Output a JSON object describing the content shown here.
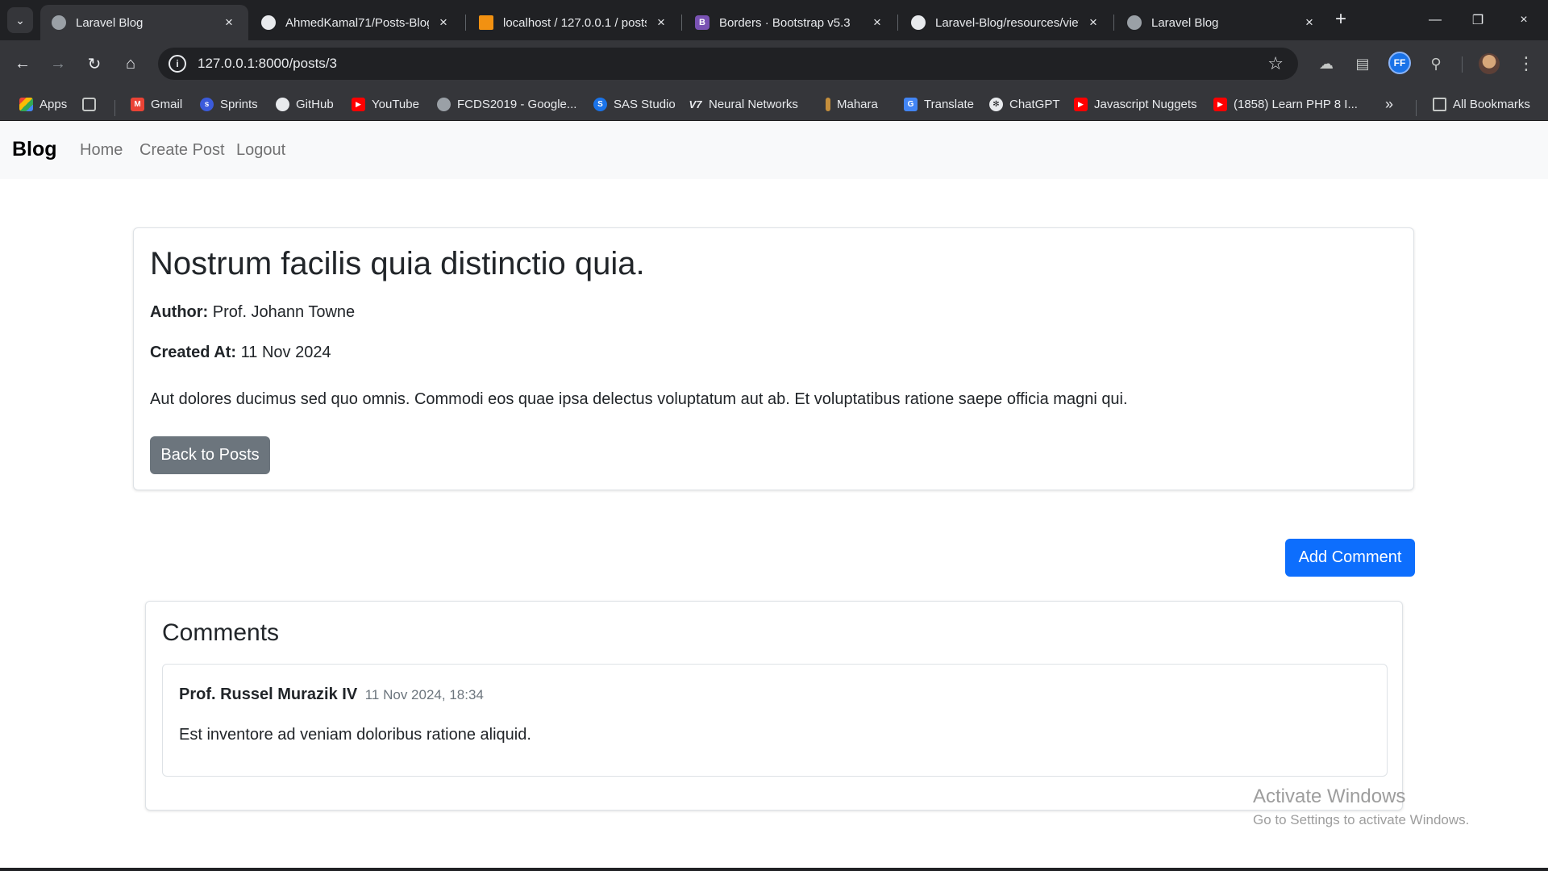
{
  "browser": {
    "tabs": [
      {
        "label": "Laravel Blog",
        "icon": "globe-icon",
        "active": true
      },
      {
        "label": "AhmedKamal71/Posts-Blog",
        "icon": "github-icon",
        "active": false
      },
      {
        "label": "localhost / 127.0.0.1 / posts",
        "icon": "phpmyadmin-icon",
        "active": false
      },
      {
        "label": "Borders · Bootstrap v5.3",
        "icon": "bootstrap-icon",
        "active": false
      },
      {
        "label": "Laravel-Blog/resources/views",
        "icon": "github-icon",
        "active": false
      },
      {
        "label": "Laravel Blog",
        "icon": "globe-icon",
        "active": false
      }
    ],
    "url": "127.0.0.1:8000/posts/3",
    "profile_ext_label": "FF",
    "bookmarks": [
      {
        "label": "Apps",
        "icon": "apps-grid-icon"
      },
      {
        "label": "Gmail",
        "icon": "gmail-icon"
      },
      {
        "label": "Sprints",
        "icon": "sprints-icon"
      },
      {
        "label": "GitHub",
        "icon": "github-icon"
      },
      {
        "label": "YouTube",
        "icon": "youtube-icon"
      },
      {
        "label": "FCDS2019 - Google...",
        "icon": "globe-icon"
      },
      {
        "label": "SAS Studio",
        "icon": "sas-icon"
      },
      {
        "label": "Neural Networks",
        "icon": "v7-icon"
      },
      {
        "label": "Mahara",
        "icon": "mahara-icon"
      },
      {
        "label": "Translate",
        "icon": "translate-icon"
      },
      {
        "label": "ChatGPT",
        "icon": "chatgpt-icon"
      },
      {
        "label": "Javascript Nuggets",
        "icon": "youtube-icon"
      },
      {
        "label": "(1858) Learn PHP 8 I...",
        "icon": "youtube-icon"
      },
      {
        "label": "All Bookmarks",
        "icon": "folder-icon"
      }
    ],
    "colors": {
      "chrome_dark": "#202124",
      "chrome_mid": "#35363a"
    }
  },
  "navbar": {
    "brand": "Blog",
    "links": [
      "Home",
      "Create Post",
      "Logout"
    ]
  },
  "post": {
    "title": "Nostrum facilis quia distinctio quia.",
    "author_label": "Author:",
    "author": "Prof. Johann Towne",
    "created_label": "Created At:",
    "created_at": "11 Nov 2024",
    "body": "Aut dolores ducimus sed quo omnis. Commodi eos quae ipsa delectus voluptatum aut ab. Et voluptatibus ratione saepe officia magni qui.",
    "back_button": "Back to Posts"
  },
  "add_comment_button": "Add Comment",
  "comments": {
    "title": "Comments",
    "items": [
      {
        "author": "Prof. Russel Murazik IV",
        "date": "11 Nov 2024, 18:34",
        "text": "Est inventore ad veniam doloribus ratione aliquid."
      }
    ]
  },
  "watermark": {
    "title": "Activate Windows",
    "subtitle": "Go to Settings to activate Windows."
  },
  "colors": {
    "primary": "#0d6efd",
    "secondary": "#6c757d",
    "navbar_bg": "#f8f9fa"
  }
}
